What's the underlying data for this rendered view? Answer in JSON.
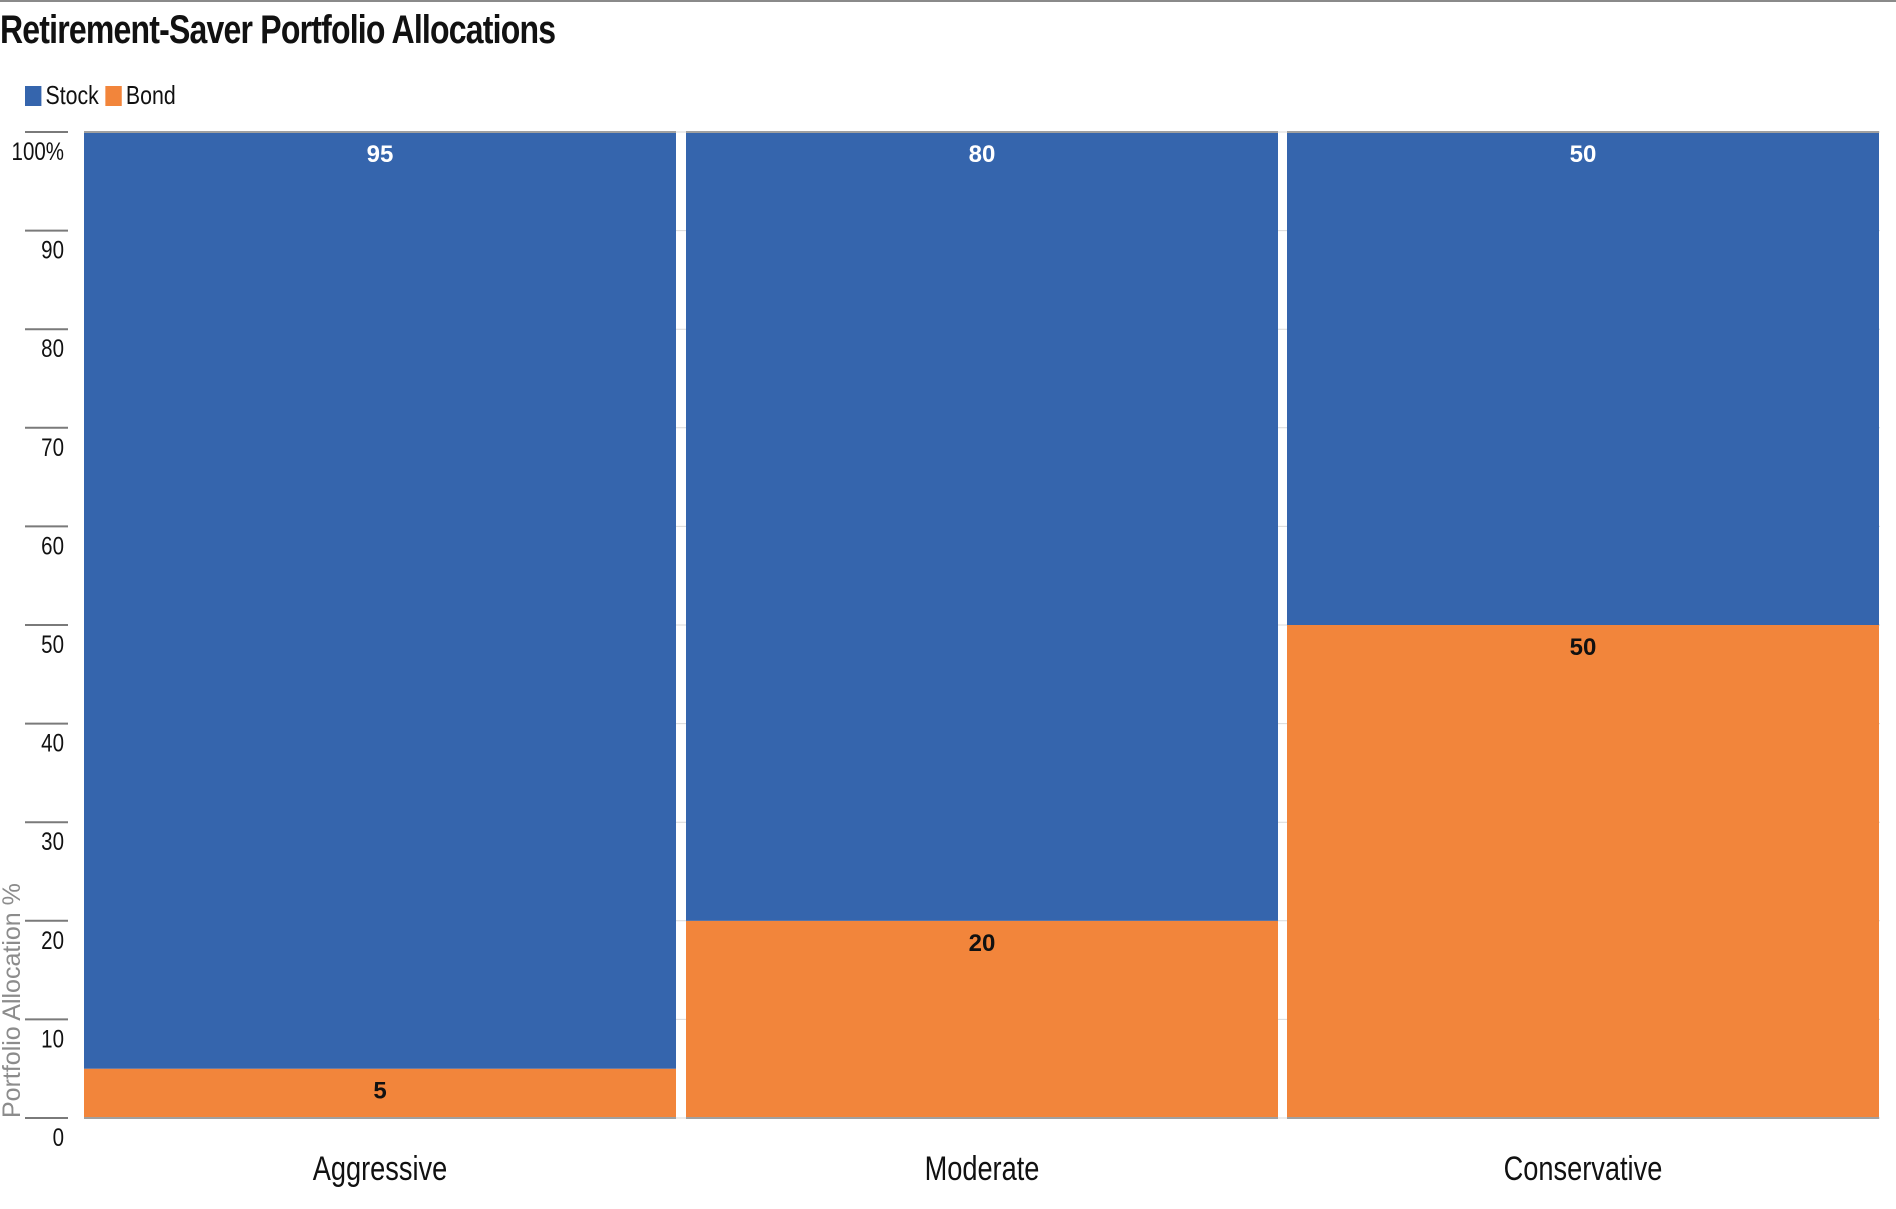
{
  "chart_data": {
    "type": "bar",
    "stacked": true,
    "title": "Retirement-Saver Portfolio Allocations",
    "xlabel": "",
    "ylabel": "Portfolio Allocation %",
    "ylim": [
      0,
      100
    ],
    "yticks": [
      0,
      10,
      20,
      30,
      40,
      50,
      60,
      70,
      80,
      90,
      100
    ],
    "ytick_labels": [
      "0",
      "10",
      "20",
      "30",
      "40",
      "50",
      "60",
      "70",
      "80",
      "90",
      "100%"
    ],
    "categories": [
      "Aggressive",
      "Moderate",
      "Conservative"
    ],
    "series": [
      {
        "name": "Bond",
        "color": "#f2853b",
        "label_color": "#111111",
        "values": [
          5,
          20,
          50
        ]
      },
      {
        "name": "Stock",
        "color": "#3565ad",
        "label_color": "#ffffff",
        "values": [
          95,
          80,
          50
        ]
      }
    ],
    "legend": {
      "position": "top-left",
      "entries": [
        {
          "name": "Stock",
          "color": "#3565ad"
        },
        {
          "name": "Bond",
          "color": "#f2853b"
        }
      ]
    },
    "grid": true
  }
}
